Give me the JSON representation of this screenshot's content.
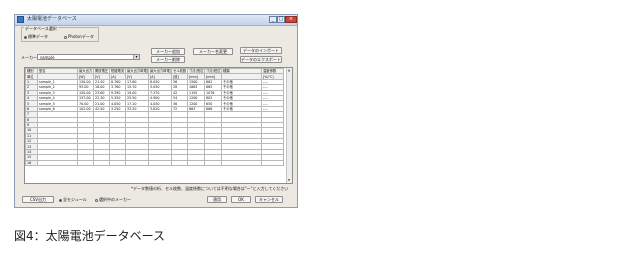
{
  "window": {
    "title": "太陽電池データベース",
    "buttons": {
      "minimize": "_",
      "maximize": "□",
      "close": "×"
    }
  },
  "data_select": {
    "legend": "データベース選択",
    "options": [
      "標準データ",
      "Photonデータ"
    ],
    "selected": "標準データ"
  },
  "maker": {
    "label": "メーカー名",
    "value": "sample"
  },
  "actions": {
    "add_maker": "メーカー追加",
    "change_maker": "メーカー名変更",
    "delete_maker": "メーカー削除",
    "import_data": "データのインポート",
    "export_data": "データのエクスポート"
  },
  "table": {
    "headers": [
      "種別",
      "型名",
      "最大出力",
      "開放電圧",
      "短絡電流",
      "最大出力時電圧",
      "最大出力時電流",
      "セル枚数",
      "寸法(長辺)",
      "寸法(短辺)",
      "種類",
      "温度係数"
    ],
    "units": [
      "単位",
      "",
      "[W]",
      "[V]",
      "[A]",
      "[V]",
      "[A]",
      "[枚]",
      "[mm]",
      "[mm]",
      "",
      "[%/℃]"
    ],
    "rows": [
      [
        "1",
        "sample_1",
        "130.00",
        "21.50",
        "8.760",
        "17.60",
        "8.050",
        "36",
        "1500",
        "662",
        "その他",
        "----"
      ],
      [
        "2",
        "sample_2",
        "95.00",
        "18.00",
        "3.760",
        "15.70",
        "3.050",
        "28",
        "1663",
        "665",
        "その他",
        "----"
      ],
      [
        "3",
        "sample_3",
        "150.00",
        "23.60",
        "9.390",
        "19.00",
        "7.370",
        "42",
        "1192",
        "1076",
        "その他",
        "----"
      ],
      [
        "4",
        "sample_4",
        "157.00",
        "22.30",
        "5.350",
        "25.50",
        "4.900",
        "54",
        "1200",
        "802",
        "その他",
        "----"
      ],
      [
        "5",
        "sample_5",
        "70.00",
        "21.00",
        "4.050",
        "17.10",
        "4.050",
        "36",
        "1200",
        "650",
        "その他",
        "----"
      ],
      [
        "6",
        "sample_6",
        "102.00",
        "42.50",
        "3.250",
        "33.50",
        "3.020",
        "72",
        "863",
        "866",
        "その他",
        "----"
      ],
      [
        "7",
        "",
        "",
        "",
        "",
        "",
        "",
        "",
        "",
        "",
        "",
        ""
      ],
      [
        "8",
        "",
        "",
        "",
        "",
        "",
        "",
        "",
        "",
        "",
        "",
        ""
      ],
      [
        "9",
        "",
        "",
        "",
        "",
        "",
        "",
        "",
        "",
        "",
        "",
        ""
      ],
      [
        "10",
        "",
        "",
        "",
        "",
        "",
        "",
        "",
        "",
        "",
        "",
        ""
      ],
      [
        "11",
        "",
        "",
        "",
        "",
        "",
        "",
        "",
        "",
        "",
        "",
        ""
      ],
      [
        "12",
        "",
        "",
        "",
        "",
        "",
        "",
        "",
        "",
        "",
        "",
        ""
      ],
      [
        "13",
        "",
        "",
        "",
        "",
        "",
        "",
        "",
        "",
        "",
        "",
        ""
      ],
      [
        "14",
        "",
        "",
        "",
        "",
        "",
        "",
        "",
        "",
        "",
        "",
        ""
      ],
      [
        "15",
        "",
        "",
        "",
        "",
        "",
        "",
        "",
        "",
        "",
        "",
        ""
      ],
      [
        "16",
        "",
        "",
        "",
        "",
        "",
        "",
        "",
        "",
        "",
        "",
        ""
      ]
    ]
  },
  "note": "*データ数値の桁、セル枚数、温度係数については不明な場合は\"ー\"と入力してください",
  "footer": {
    "csv": "CSV出力",
    "scope_options": [
      "全モジュール",
      "選択中のメーカー"
    ],
    "scope_selected": "全モジュール",
    "apply": "適用",
    "ok": "OK",
    "cancel": "キャンセル"
  },
  "caption": "図4：太陽電池データベース",
  "colors": {
    "title_bar": "#c2d2ea",
    "window_bg": "#ece9e2",
    "close_button": "#c9473a",
    "grid_header": "#f1f1f1"
  }
}
